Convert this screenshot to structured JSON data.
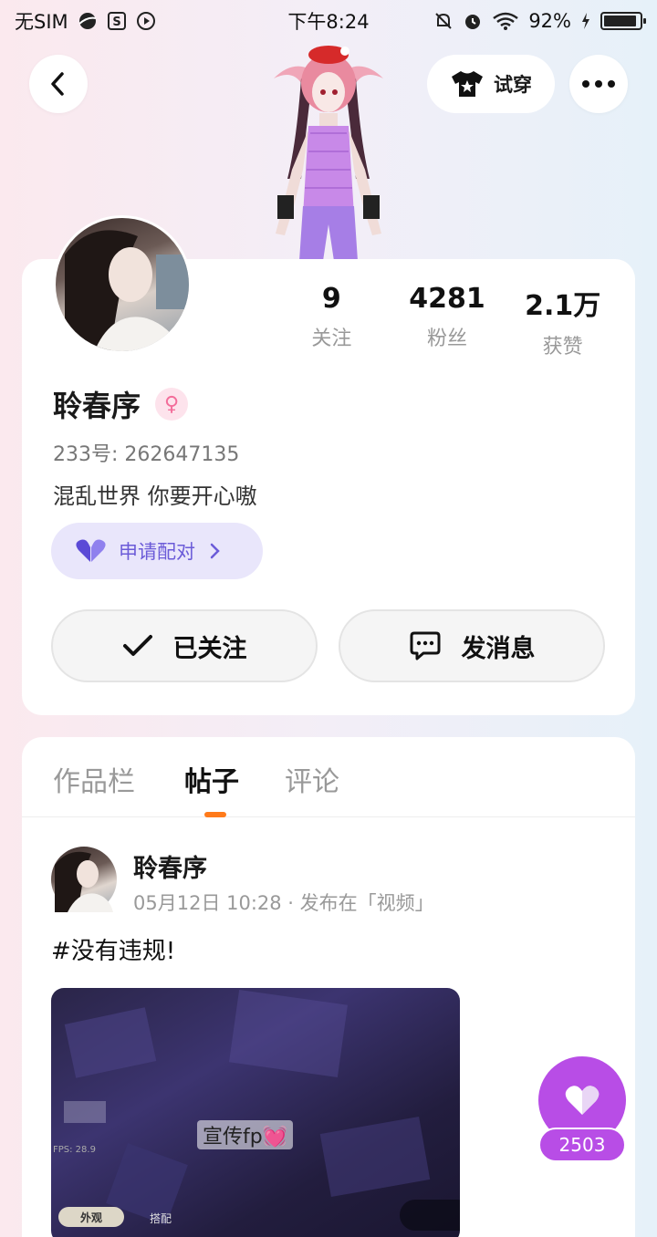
{
  "status_bar": {
    "carrier": "无SIM",
    "time": "下午8:24",
    "battery": "92%",
    "battery_level": 0.92
  },
  "header": {
    "back_icon": "chevron-left-icon",
    "try_on_label": "试穿",
    "more_icon": "more-dots-icon"
  },
  "profile": {
    "stats": [
      {
        "value": "9",
        "label": "关注"
      },
      {
        "value": "4281",
        "label": "粉丝"
      },
      {
        "value": "2.1万",
        "label": "获赞"
      }
    ],
    "name": "聆春序",
    "gender_icon": "female-icon",
    "uid": "233号: 262647135",
    "bio": "混乱世界 你要开心嗷",
    "pair_label": "申请配对",
    "follow_label": "已关注",
    "message_label": "发消息"
  },
  "tabs": [
    "作品栏",
    "帖子",
    "评论"
  ],
  "active_tab": 1,
  "post": {
    "author": "聆春序",
    "meta": "05月12日 10:28 · 发布在「视频」",
    "text": "#没有违规!",
    "video_caption": "宣传fp💓",
    "video_fps": "FPS: 28.9",
    "video_tab_1": "外观",
    "video_tab_2": "搭配"
  },
  "like": {
    "count": "2503"
  },
  "colors": {
    "accent_purple": "#b84de6",
    "pair_bg": "#e9e6fb",
    "pair_text": "#6b5bd8",
    "tab_underline": "#ff7a1a",
    "gender_pink": "#f36d9a"
  }
}
